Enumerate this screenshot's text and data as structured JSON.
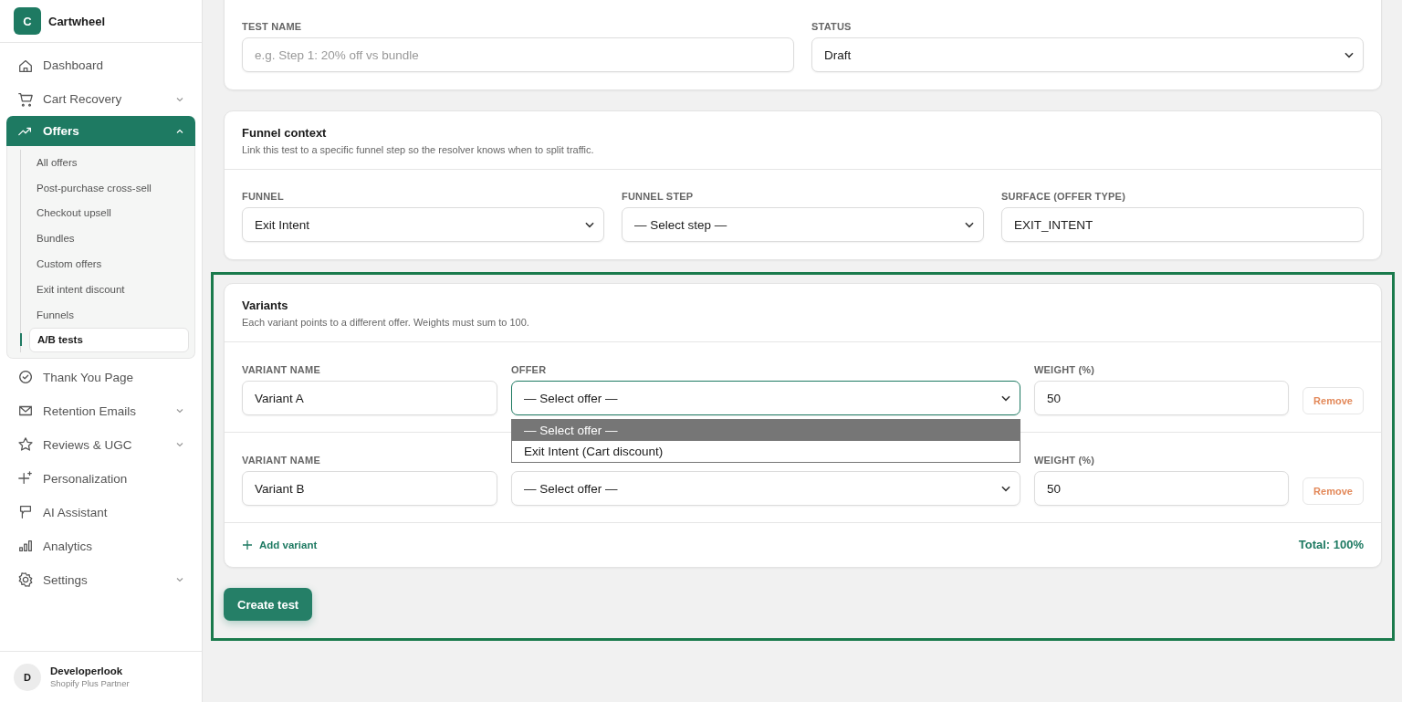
{
  "brand": {
    "logo_letter": "C",
    "name": "Cartwheel"
  },
  "sidebar": {
    "items": [
      {
        "label": "Dashboard",
        "selected": false
      },
      {
        "label": "Cart Recovery",
        "selected": false,
        "expanded": false
      },
      {
        "label": "Offers",
        "selected": true,
        "expanded": true,
        "children": [
          {
            "label": "All offers",
            "selected": false
          },
          {
            "label": "Post-purchase cross-sell",
            "selected": false
          },
          {
            "label": "Checkout upsell",
            "selected": false
          },
          {
            "label": "Bundles",
            "selected": false
          },
          {
            "label": "Custom offers",
            "selected": false
          },
          {
            "label": "Exit intent discount",
            "selected": false
          },
          {
            "label": "Funnels",
            "selected": false
          },
          {
            "label": "A/B tests",
            "selected": true
          }
        ]
      },
      {
        "label": "Thank You Page",
        "selected": false
      },
      {
        "label": "Retention Emails",
        "selected": false,
        "expanded": false
      },
      {
        "label": "Reviews & UGC",
        "selected": false,
        "expanded": false
      },
      {
        "label": "Personalization",
        "selected": false
      },
      {
        "label": "AI Assistant",
        "selected": false
      },
      {
        "label": "Analytics",
        "selected": false
      },
      {
        "label": "Settings",
        "selected": false,
        "expanded": false
      }
    ]
  },
  "user": {
    "avatar_letter": "D",
    "name": "Developerlook",
    "role": "Shopify Plus Partner"
  },
  "basics": {
    "test_name": {
      "label": "TEST NAME",
      "placeholder": "e.g. Step 1: 20% off vs bundle"
    },
    "status": {
      "label": "STATUS",
      "value": "Draft"
    }
  },
  "funnel_context": {
    "title": "Funnel context",
    "description": "Link this test to a specific funnel step so the resolver knows when to split traffic.",
    "fields": [
      {
        "kind": "select",
        "label": "FUNNEL",
        "value": "Exit Intent"
      },
      {
        "kind": "select",
        "label": "FUNNEL STEP",
        "value": "— Select step —"
      },
      {
        "kind": "input",
        "label": "SURFACE (OFFER TYPE)",
        "value": "EXIT_INTENT"
      }
    ]
  },
  "variants": {
    "title": "Variants",
    "description": "Each variant points to a different offer. Weights must sum to 100.",
    "rows": [
      {
        "name_label": "VARIANT NAME",
        "name": "Variant A",
        "offer_label": "OFFER",
        "offer": "— Select offer —",
        "focused": true,
        "weight_label": "WEIGHT (%)",
        "weight": "50",
        "remove": "Remove"
      },
      {
        "name_label": "VARIANT NAME",
        "name": "Variant B",
        "offer": "— Select offer —",
        "focused": false,
        "weight_label": "WEIGHT (%)",
        "weight": "50",
        "remove": "Remove"
      }
    ],
    "dropdown": [
      {
        "label": "— Select offer —",
        "selected": true
      },
      {
        "label": "Exit Intent (Cart discount)",
        "selected": false
      }
    ],
    "add_variant": "Add variant",
    "total": "Total: 100%"
  },
  "create_button": "Create test"
}
